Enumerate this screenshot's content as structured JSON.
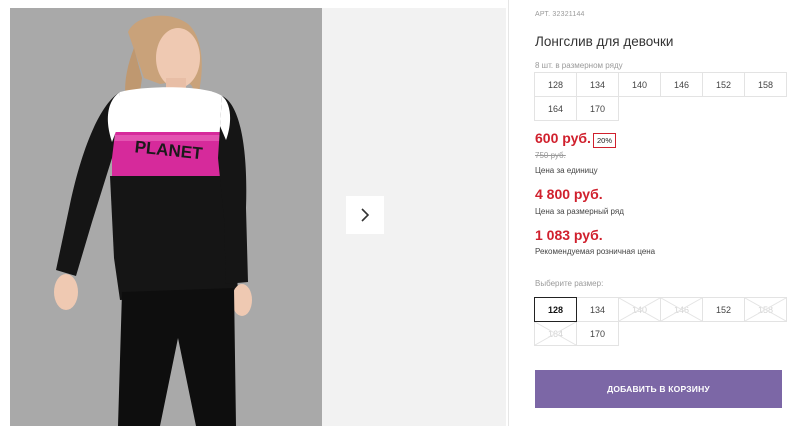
{
  "product": {
    "article": "АРТ. 32321144",
    "title": "Лонгслив для девочки",
    "series_label": "8 шт. в размерном ряду",
    "series_sizes": [
      "128",
      "134",
      "140",
      "146",
      "152",
      "158",
      "164",
      "170"
    ],
    "shirt_print": "PLANET"
  },
  "pricing": {
    "unit_price": "600 руб.",
    "discount": "20%",
    "old_price": "750 руб.",
    "unit_label": "Цена за единицу",
    "series_price": "4 800 руб.",
    "series_label": "Цена за размерный ряд",
    "retail_price": "1 083 руб.",
    "retail_label": "Рекомендуемая розничная цена"
  },
  "size_picker": {
    "label": "Выберите размер:",
    "sizes": [
      {
        "label": "128",
        "state": "selected"
      },
      {
        "label": "134",
        "state": "available"
      },
      {
        "label": "140",
        "state": "unavailable"
      },
      {
        "label": "146",
        "state": "unavailable"
      },
      {
        "label": "152",
        "state": "available"
      },
      {
        "label": "158",
        "state": "unavailable"
      },
      {
        "label": "164",
        "state": "unavailable"
      },
      {
        "label": "170",
        "state": "available"
      }
    ]
  },
  "cart": {
    "add_label": "ДОБАВИТЬ В КОРЗИНУ"
  },
  "icons": {
    "next": "chevron-right-icon"
  },
  "colors": {
    "price": "#d0202d",
    "button": "#7c67a6",
    "accent_print": "#d62a9b"
  }
}
